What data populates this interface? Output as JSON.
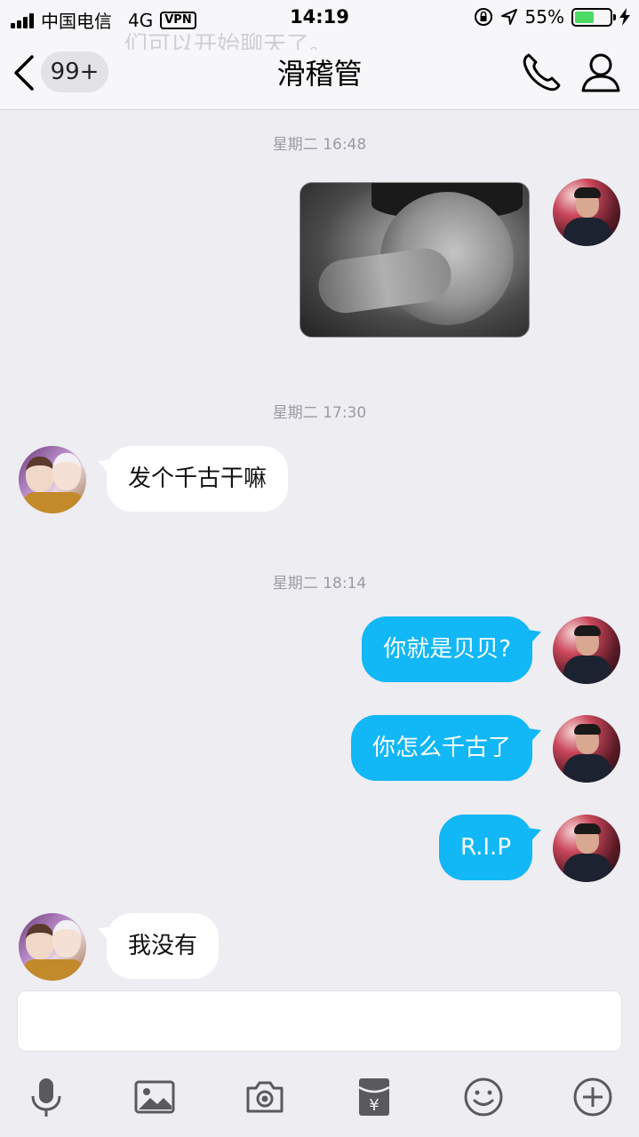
{
  "status_bar": {
    "carrier": "中国电信",
    "network": "4G",
    "vpn": "VPN",
    "time": "14:19",
    "battery_percent": "55%",
    "battery_level": 0.55
  },
  "header": {
    "ghost_text": "们可以开始聊天了。",
    "unread_badge": "99+",
    "title": "滑稽管"
  },
  "messages": [
    {
      "type": "timestamp",
      "text": "星期二 16:48"
    },
    {
      "type": "image",
      "sender": "me"
    },
    {
      "type": "timestamp",
      "text": "星期二 17:30"
    },
    {
      "type": "text",
      "sender": "other",
      "text": "发个千古干嘛"
    },
    {
      "type": "timestamp",
      "text": "星期二 18:14"
    },
    {
      "type": "text",
      "sender": "me",
      "text": "你就是贝贝?"
    },
    {
      "type": "text",
      "sender": "me",
      "text": "你怎么千古了"
    },
    {
      "type": "text",
      "sender": "me",
      "text": "R.I.P"
    },
    {
      "type": "text",
      "sender": "other",
      "text": "我没有"
    }
  ],
  "input": {
    "value": "",
    "placeholder": ""
  },
  "toolbar": {
    "icons": [
      "microphone-icon",
      "image-icon",
      "camera-icon",
      "red-packet-icon",
      "emoji-icon",
      "plus-icon"
    ]
  },
  "colors": {
    "my_bubble": "#12b7f5",
    "other_bubble": "#ffffff",
    "background": "#ededf2",
    "battery_fill": "#4cd964"
  }
}
